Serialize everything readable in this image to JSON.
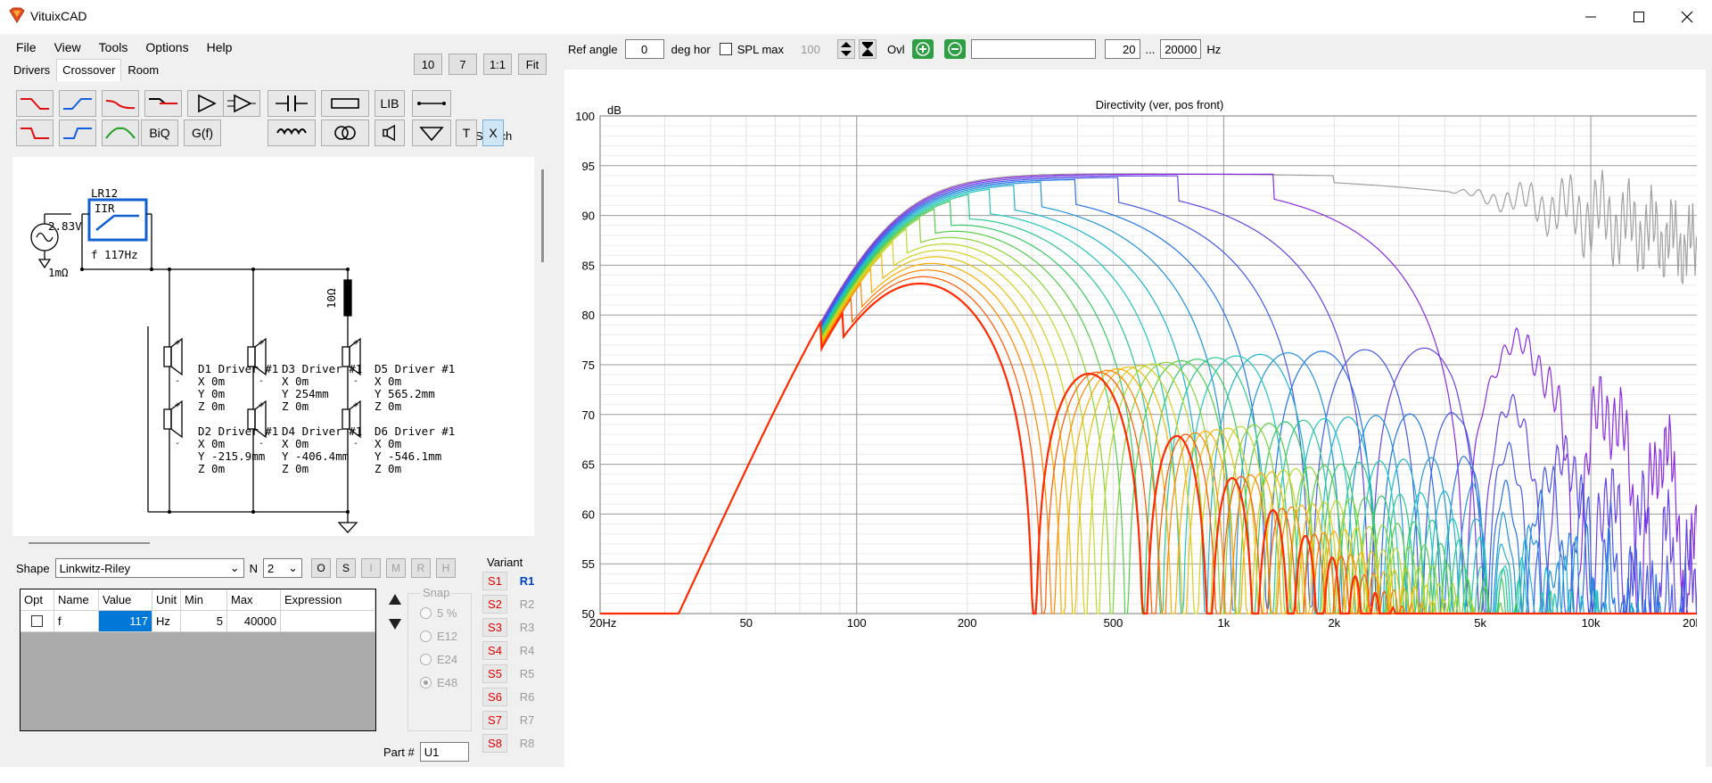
{
  "app": {
    "title": "VituixCAD"
  },
  "window": {
    "minimize": "minimize",
    "maximize": "maximize",
    "close": "close"
  },
  "menu": [
    "File",
    "View",
    "Tools",
    "Options",
    "Help"
  ],
  "zoom_buttons": [
    "10",
    "7",
    "1:1",
    "Fit"
  ],
  "tabs": [
    "Drivers",
    "Crossover",
    "Room"
  ],
  "active_tab": "Crossover",
  "toolbar": {
    "lib": "LIB",
    "biq": "BiQ",
    "gf": "G(f)",
    "t": "T",
    "x": "X",
    "stretch_label": "Stretch",
    "stretch_checked": true
  },
  "schematic": {
    "source_voltage": "2.83V",
    "source_resistance": "1mΩ",
    "filter_title": "LR12",
    "filter_type": "IIR",
    "filter_freq": "f  117Hz",
    "resistor": "10Ω",
    "drivers": [
      {
        "name": "D1 Driver #1",
        "x": "X 0m",
        "y": "Y 0m",
        "z": "Z 0m"
      },
      {
        "name": "D3 Driver #1",
        "x": "X 0m",
        "y": "Y 254mm",
        "z": "Z 0m"
      },
      {
        "name": "D5 Driver #1",
        "x": "X 0m",
        "y": "Y 565.2mm",
        "z": "Z 0m"
      },
      {
        "name": "D2 Driver #1",
        "x": "X 0m",
        "y": "Y -215.9mm",
        "z": "Z 0m"
      },
      {
        "name": "D4 Driver #1",
        "x": "X 0m",
        "y": "Y -406.4mm",
        "z": "Z 0m"
      },
      {
        "name": "D6 Driver #1",
        "x": "X 0m",
        "y": "Y -546.1mm",
        "z": "Z 0m"
      }
    ]
  },
  "shape": {
    "label": "Shape",
    "value": "Linkwitz-Riley",
    "n_label": "N",
    "n_value": "2",
    "buttons": [
      "O",
      "S",
      "I",
      "M",
      "R",
      "H"
    ]
  },
  "params": {
    "columns": [
      "Opt",
      "Name",
      "Value",
      "Unit",
      "Min",
      "Max",
      "Expression"
    ],
    "rows": [
      {
        "opt": false,
        "name": "f",
        "value": "117",
        "unit": "Hz",
        "min": "5",
        "max": "40000",
        "expression": ""
      }
    ]
  },
  "snap": {
    "title": "Snap",
    "options": [
      "5 %",
      "E12",
      "E24",
      "E48"
    ],
    "selected": "E48"
  },
  "variant": {
    "label": "Variant",
    "s": [
      "S1",
      "S2",
      "S3",
      "S4",
      "S5",
      "S6",
      "S7",
      "S8"
    ],
    "r": [
      "R1",
      "R2",
      "R3",
      "R4",
      "R5",
      "R6",
      "R7",
      "R8"
    ],
    "active_r": "R1"
  },
  "part": {
    "label": "Part #",
    "value": "U1"
  },
  "controls": {
    "ref_angle_label": "Ref angle",
    "ref_angle_value": "0",
    "deg_label": "deg hor",
    "spl_max_label": "SPL max",
    "spl_max_value": "100",
    "ovl_label": "Ovl",
    "range_from": "20",
    "range_sep": "...",
    "range_to": "20000",
    "hz_label": "Hz"
  },
  "chart_data": {
    "type": "line",
    "title": "Directivity (ver, pos front)",
    "ylabel": "dB",
    "xlabel": "",
    "xscale": "log",
    "xlim": [
      20,
      20000
    ],
    "ylim": [
      50,
      100
    ],
    "x_ticks": [
      {
        "v": 20,
        "label": "20Hz"
      },
      {
        "v": 50,
        "label": "50"
      },
      {
        "v": 100,
        "label": "100"
      },
      {
        "v": 200,
        "label": "200"
      },
      {
        "v": 500,
        "label": "500"
      },
      {
        "v": 1000,
        "label": "1k"
      },
      {
        "v": 2000,
        "label": "2k"
      },
      {
        "v": 5000,
        "label": "5k"
      },
      {
        "v": 10000,
        "label": "10k"
      },
      {
        "v": 20000,
        "label": "20k"
      }
    ],
    "y_ticks": [
      50,
      55,
      60,
      65,
      70,
      75,
      80,
      85,
      90,
      95,
      100
    ],
    "grid": true,
    "series_count": 19,
    "series_colors_from": "#ff2a00",
    "series_colors_to": "#8a2be2",
    "reference_color": "#a0a0a0",
    "peak_db": 94.3,
    "peak_hz": 120
  }
}
